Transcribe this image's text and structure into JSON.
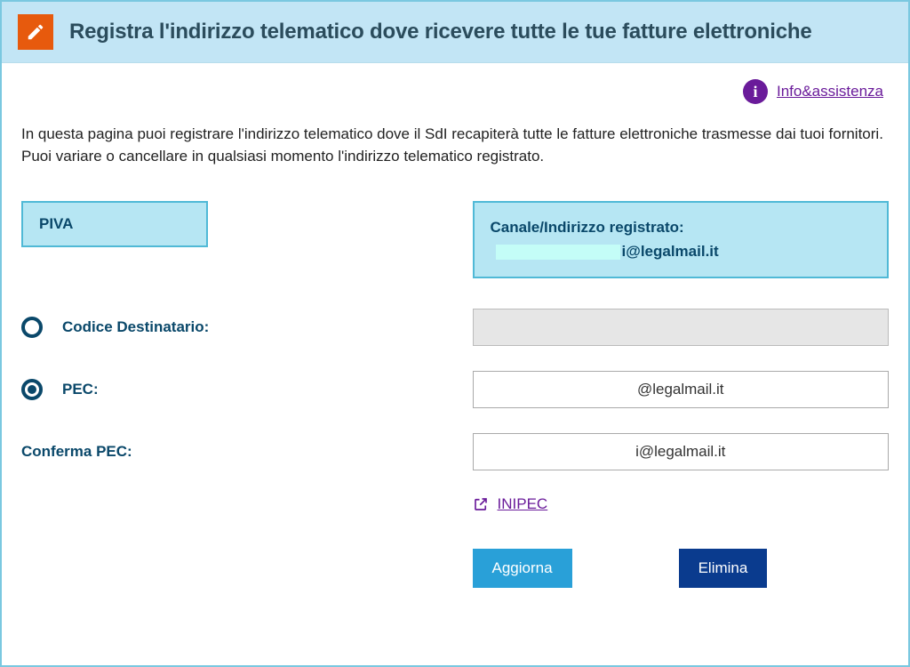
{
  "header": {
    "title": "Registra l'indirizzo telematico dove ricevere tutte le tue fatture elettroniche"
  },
  "help": {
    "icon_letter": "i",
    "label": "Info&assistenza"
  },
  "description": "In questa pagina puoi registrare l'indirizzo telematico dove il SdI recapiterà tutte le fatture elettroniche trasmesse dai tuoi fornitori. Puoi variare o cancellare in qualsiasi momento l'indirizzo telematico registrato.",
  "boxes": {
    "piva_label": "PIVA",
    "registered_label": "Canale/Indirizzo registrato:",
    "registered_value_suffix": "i@legalmail.it"
  },
  "form": {
    "codice_dest_label": "Codice Destinatario:",
    "pec_label": "PEC:",
    "pec_value": "@legalmail.it",
    "conferma_pec_label": "Conferma PEC:",
    "conferma_pec_value": "i@legalmail.it",
    "inipec_label": "INIPEC"
  },
  "actions": {
    "update": "Aggiorna",
    "delete": "Elimina"
  }
}
